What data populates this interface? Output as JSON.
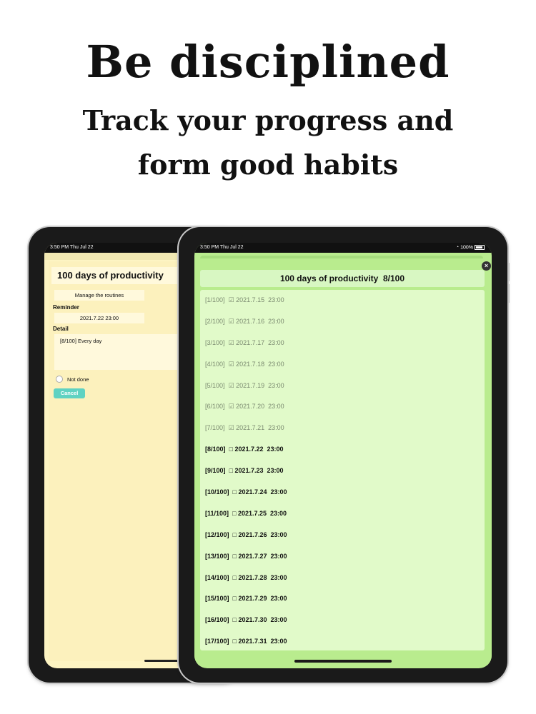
{
  "promo": {
    "headline": "Be disciplined",
    "subline1": "Track your progress and",
    "subline2": "form good habits"
  },
  "back_tablet": {
    "status_time": "3:50 PM   Thu Jul 22",
    "title": "100 days of productivity",
    "manage_button": "Manage the routines",
    "reminder_label": "Reminder",
    "reminder_value": "2021.7.22  23:00",
    "detail_label": "Detail",
    "detail_value": "[8/100] Every day",
    "status_option": "Not done",
    "cancel_button": "Cancel"
  },
  "front_tablet": {
    "status_time": "3:50 PM   Thu Jul 22",
    "battery": "100%",
    "modal_title": "100 days of productivity  8/100",
    "entries": [
      {
        "label": "[1/100]  ☑ 2021.7.15  23:00",
        "done": true
      },
      {
        "label": "[2/100]  ☑ 2021.7.16  23:00",
        "done": true
      },
      {
        "label": "[3/100]  ☑ 2021.7.17  23:00",
        "done": true
      },
      {
        "label": "[4/100]  ☑ 2021.7.18  23:00",
        "done": true
      },
      {
        "label": "[5/100]  ☑ 2021.7.19  23:00",
        "done": true
      },
      {
        "label": "[6/100]  ☑ 2021.7.20  23:00",
        "done": true
      },
      {
        "label": "[7/100]  ☑ 2021.7.21  23:00",
        "done": true
      },
      {
        "label": "[8/100]  □ 2021.7.22  23:00",
        "done": false
      },
      {
        "label": "[9/100]  □ 2021.7.23  23:00",
        "done": false
      },
      {
        "label": "[10/100]  □ 2021.7.24  23:00",
        "done": false
      },
      {
        "label": "[11/100]  □ 2021.7.25  23:00",
        "done": false
      },
      {
        "label": "[12/100]  □ 2021.7.26  23:00",
        "done": false
      },
      {
        "label": "[13/100]  □ 2021.7.27  23:00",
        "done": false
      },
      {
        "label": "[14/100]  □ 2021.7.28  23:00",
        "done": false
      },
      {
        "label": "[15/100]  □ 2021.7.29  23:00",
        "done": false
      },
      {
        "label": "[16/100]  □ 2021.7.30  23:00",
        "done": false
      },
      {
        "label": "[17/100]  □ 2021.7.31  23:00",
        "done": false
      }
    ],
    "close_icon": "close-icon"
  },
  "colors": {
    "back_screen": "#fdf4c3",
    "front_screen": "#b9ec8e",
    "list_background": "#e1fac9",
    "cancel_button": "#5fd2c2"
  }
}
